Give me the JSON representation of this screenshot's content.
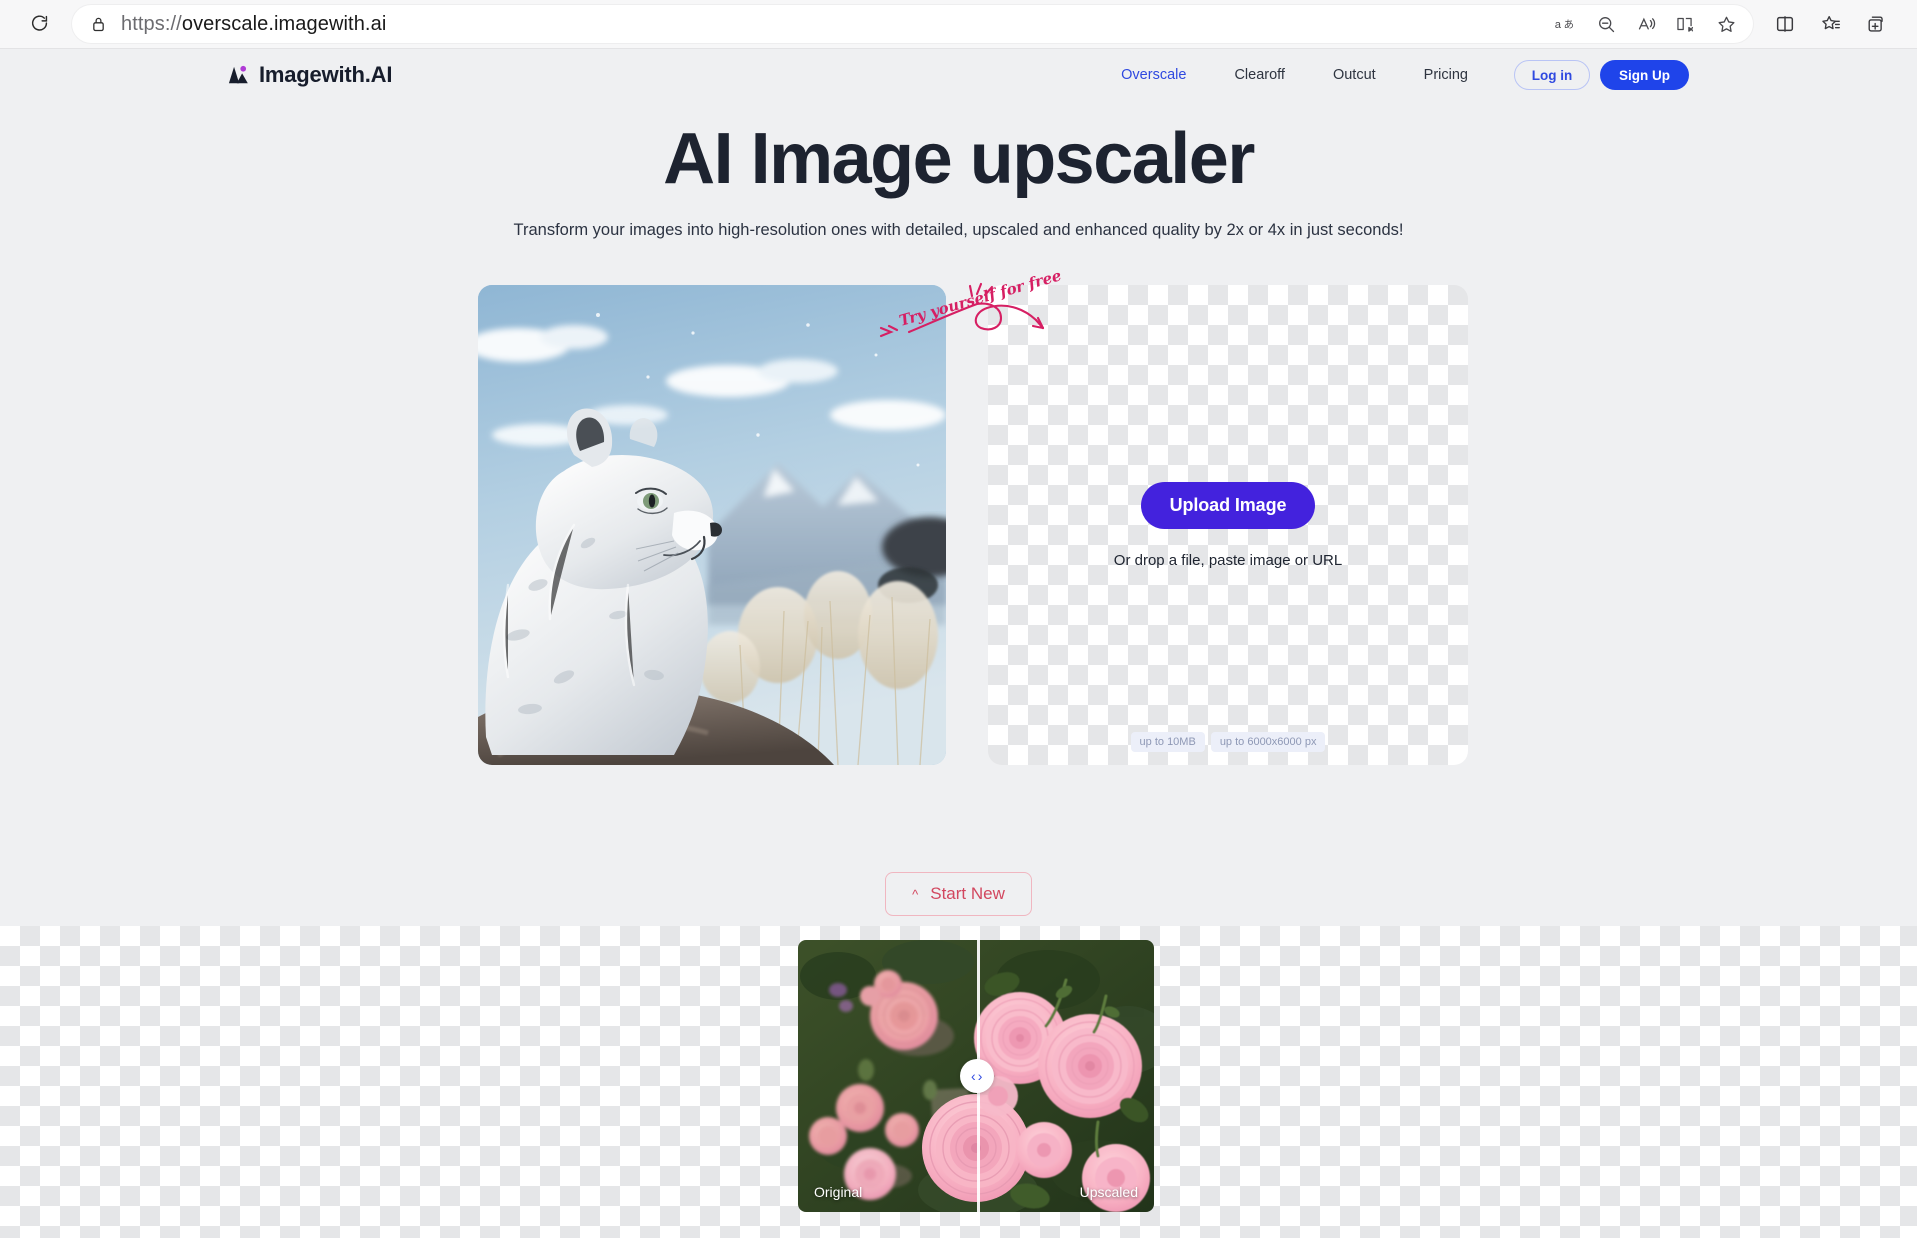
{
  "browser": {
    "reload_icon": "refresh-icon",
    "lock_icon": "lock-icon",
    "url_scheme": "https://",
    "url_host": "overscale.imagewith.ai",
    "url_full": "https://overscale.imagewith.ai",
    "toolbar_icons": [
      "translate-icon",
      "zoom-out-icon",
      "read-aloud-icon",
      "immersive-reader-icon",
      "favorite-star-icon",
      "split-screen-icon",
      "collections-icon",
      "browser-essentials-icon"
    ]
  },
  "header": {
    "logo_text": "Imagewith.AI",
    "logo_accent": "#b03bd6",
    "logo_dark": "#171d2c",
    "nav": [
      {
        "label": "Overscale",
        "active": true
      },
      {
        "label": "Clearoff",
        "active": false
      },
      {
        "label": "Outcut",
        "active": false
      },
      {
        "label": "Pricing",
        "active": false
      }
    ],
    "login_label": "Log in",
    "signup_label": "Sign Up",
    "accent_blue": "#2f49e0",
    "signup_bg": "#1f44ea"
  },
  "hero": {
    "title": "AI Image upscaler",
    "subtitle": "Transform your images into high-resolution ones with detailed, upscaled and enhanced quality by 2x or 4x in just seconds!"
  },
  "workspace": {
    "preview_alt": "snow-leopard-cub-on-rock-with-mountains",
    "annotation_text": "Try yourself for free",
    "annotation_color": "#d61f63",
    "upload_button": "Upload Image",
    "upload_button_bg": "#4322dd",
    "drop_hint": "Or drop a file, paste image or URL",
    "limits": [
      "up to 10MB",
      "up to 6000x6000 px"
    ]
  },
  "start_new": {
    "label": "Start New",
    "icon": "chevron-up-icon",
    "color": "#d2475f",
    "border_color": "#f0b6c0"
  },
  "comparison": {
    "image_alt": "pink-roses-garden",
    "left_label": "Original",
    "right_label": "Upscaled",
    "handle_left_icon": "chevron-left-icon",
    "handle_right_icon": "chevron-right-icon",
    "handle_color": "#2f49e0",
    "divider_position_pct": 50
  }
}
